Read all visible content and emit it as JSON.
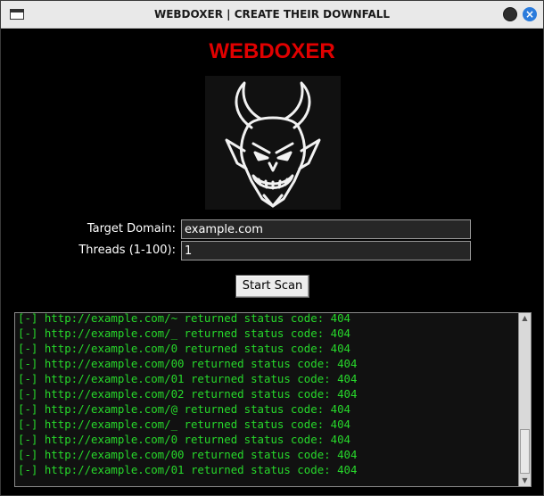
{
  "window": {
    "title": "WEBDOXER | CREATE THEIR DOWNFALL",
    "close_glyph": "×"
  },
  "app": {
    "heading": "WEBDOXER",
    "logo_icon": "devil-face-icon"
  },
  "form": {
    "domain_label": "Target Domain:",
    "domain_value": "example.com",
    "threads_label": "Threads (1-100):",
    "threads_value": "1",
    "scan_button": "Start Scan"
  },
  "output": {
    "lines": [
      "[-] http://example.com/~ returned status code: 404",
      "[-] http://example.com/_ returned status code: 404",
      "[-] http://example.com/0 returned status code: 404",
      "[-] http://example.com/00 returned status code: 404",
      "[-] http://example.com/01 returned status code: 404",
      "[-] http://example.com/02 returned status code: 404",
      "[-] http://example.com/@ returned status code: 404",
      "[-] http://example.com/_ returned status code: 404",
      "[-] http://example.com/0 returned status code: 404",
      "[-] http://example.com/00 returned status code: 404",
      "[-] http://example.com/01 returned status code: 404"
    ]
  },
  "colors": {
    "heading": "#e00000",
    "log_text": "#27d82b",
    "background": "#000000"
  }
}
